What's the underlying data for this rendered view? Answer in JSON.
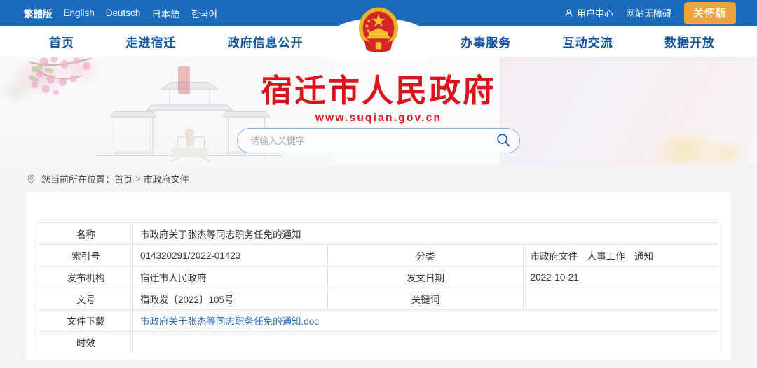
{
  "topbar": {
    "languages": [
      {
        "label": "繁體版",
        "bold": true
      },
      {
        "label": "English",
        "bold": false
      },
      {
        "label": "Deutsch",
        "bold": false
      },
      {
        "label": "日本語",
        "bold": false
      },
      {
        "label": "한국어",
        "bold": false
      }
    ],
    "user_center": "用户中心",
    "accessibility": "网站无障碍",
    "care_version": "关怀版",
    "bg_color": "#1a6bbe",
    "care_btn_color": "#efa33e"
  },
  "nav": {
    "items": [
      {
        "label": "首页"
      },
      {
        "label": "走进宿迁"
      },
      {
        "label": "政府信息公开"
      },
      {
        "label": "办事服务"
      },
      {
        "label": "互动交流"
      },
      {
        "label": "数据开放"
      }
    ],
    "text_color": "#13539c"
  },
  "banner": {
    "site_title": "宿迁市人民政府",
    "site_url": "www.suqian.gov.cn",
    "title_color": "#d9151b",
    "search": {
      "value": "",
      "placeholder": "请输入关键字"
    }
  },
  "breadcrumb": {
    "prefix": "您当前所在位置：",
    "home": "首页",
    "separator": ">",
    "current": "市政府文件"
  },
  "document": {
    "rows": [
      {
        "label": "名称",
        "value": "市政府关于张杰等同志职务任免的通知",
        "span": true
      },
      {
        "label": "索引号",
        "value": "014320291/2022-01423",
        "label2": "分类",
        "value2": "市政府文件　人事工作　通知"
      },
      {
        "label": "发布机构",
        "value": "宿迁市人民政府",
        "label2": "发文日期",
        "value2": "2022-10-21"
      },
      {
        "label": "文号",
        "value": "宿政发〔2022〕105号",
        "label2": "关键词",
        "value2": ""
      },
      {
        "label": "文件下载",
        "value": "市政府关于张杰等同志职务任免的通知.doc",
        "span": true,
        "link": true
      },
      {
        "label": "时效",
        "value": "",
        "span": true
      }
    ]
  }
}
